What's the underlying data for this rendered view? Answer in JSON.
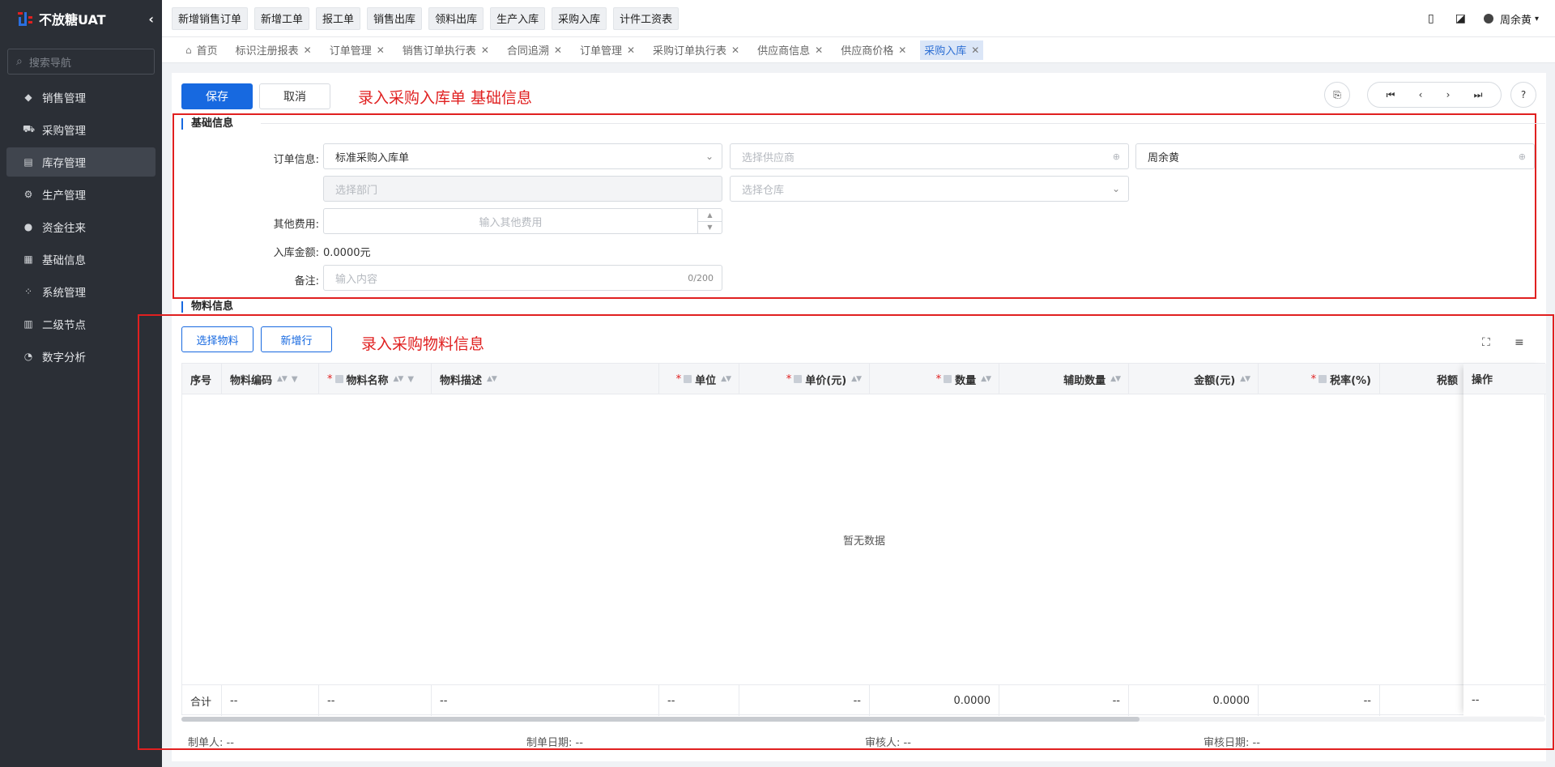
{
  "app": {
    "brand": "不放糖UAT"
  },
  "sidebar": {
    "search_placeholder": "搜索导航",
    "items": [
      {
        "label": "销售管理",
        "icon": "tag-icon"
      },
      {
        "label": "采购管理",
        "icon": "cart-icon"
      },
      {
        "label": "库存管理",
        "icon": "warehouse-icon",
        "active": true
      },
      {
        "label": "生产管理",
        "icon": "production-icon"
      },
      {
        "label": "资金往来",
        "icon": "money-icon"
      },
      {
        "label": "基础信息",
        "icon": "grid-icon"
      },
      {
        "label": "系统管理",
        "icon": "settings-icon"
      },
      {
        "label": "二级节点",
        "icon": "doc-icon"
      },
      {
        "label": "数字分析",
        "icon": "pie-icon"
      }
    ]
  },
  "topbar": {
    "quick_actions": [
      "新增销售订单",
      "新增工单",
      "报工单",
      "销售出库",
      "领料出库",
      "生产入库",
      "采购入库",
      "计件工资表"
    ],
    "user_name": "周余黄"
  },
  "tabs": [
    {
      "label": "首页",
      "home": true
    },
    {
      "label": "标识注册报表"
    },
    {
      "label": "订单管理"
    },
    {
      "label": "销售订单执行表"
    },
    {
      "label": "合同追溯"
    },
    {
      "label": "订单管理"
    },
    {
      "label": "采购订单执行表"
    },
    {
      "label": "供应商信息"
    },
    {
      "label": "供应商价格"
    },
    {
      "label": "采购入库",
      "active": true
    }
  ],
  "toolbar": {
    "save": "保存",
    "cancel": "取消"
  },
  "annotations": {
    "basic": "录入采购入库单 基础信息",
    "material": "录入采购物料信息"
  },
  "basic": {
    "section_title": "基础信息",
    "order_label": "订单信息:",
    "order_type": "标准采购入库单",
    "supplier_placeholder": "选择供应商",
    "handler": "周余黄",
    "dept_placeholder": "选择部门",
    "warehouse_placeholder": "选择仓库",
    "other_fee_label": "其他费用:",
    "other_fee_placeholder": "输入其他费用",
    "amount_label": "入库金额:",
    "amount_value": "0.0000",
    "amount_unit": "元",
    "remark_label": "备注:",
    "remark_placeholder": "输入内容",
    "remark_counter": "0/200"
  },
  "material": {
    "section_title": "物料信息",
    "select_btn": "选择物料",
    "add_row_btn": "新增行",
    "columns": {
      "index": "序号",
      "code": "物料编码",
      "name": "物料名称",
      "desc": "物料描述",
      "unit": "单位",
      "price": "单价(元)",
      "qty": "数量",
      "aux_qty": "辅助数量",
      "amount": "金额(元)",
      "tax_rate": "税率(%)",
      "tax_partial": "税额",
      "op": "操作"
    },
    "empty_text": "暂无数据",
    "summary": {
      "label": "合计",
      "code": "--",
      "name": "--",
      "desc": "--",
      "unit": "--",
      "price": "--",
      "qty": "0.0000",
      "aux_qty": "--",
      "amount": "0.0000",
      "tax_rate": "--",
      "op": "--"
    }
  },
  "footer": {
    "creator": "制单人: --",
    "create_date": "制单日期: --",
    "auditor": "审核人: --",
    "audit_date": "审核日期: --"
  }
}
